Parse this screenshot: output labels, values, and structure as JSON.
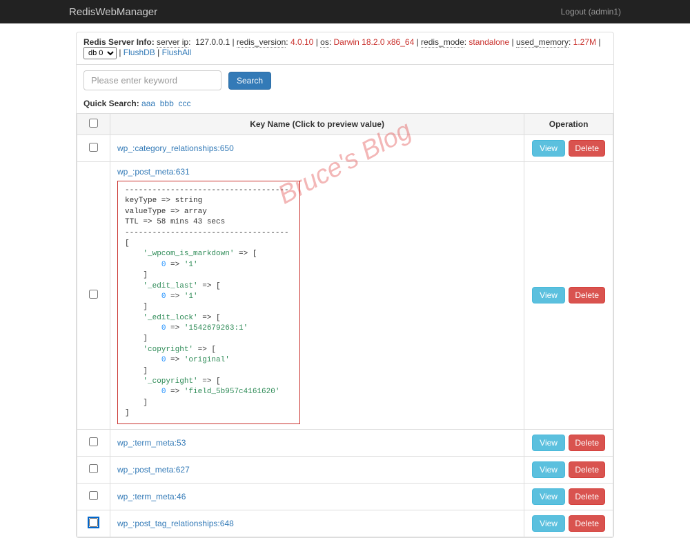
{
  "navbar": {
    "brand": "RedisWebManager",
    "logout": "Logout (admin1)"
  },
  "server_info": {
    "label": "Redis Server Info:",
    "server_ip_label": "server ip",
    "server_ip_value": "127.0.0.1",
    "redis_version_label": "redis_version",
    "redis_version_value": "4.0.10",
    "os_label": "os",
    "os_value": "Darwin 18.2.0 x86_64",
    "redis_mode_label": "redis_mode",
    "redis_mode_value": "standalone",
    "used_memory_label": "used_memory",
    "used_memory_value": "1.27M",
    "db_selected": "db 0",
    "flushdb": "FlushDB",
    "flushall": "FlushAll"
  },
  "search": {
    "placeholder": "Please enter keyword",
    "button": "Search"
  },
  "quick_search": {
    "label": "Quick Search:",
    "items": [
      "aaa",
      "bbb",
      "ccc"
    ]
  },
  "table": {
    "header": {
      "check": "",
      "keyname": "Key Name (Click to preview value)",
      "operation": "Operation"
    },
    "buttons": {
      "view": "View",
      "delete": "Delete"
    },
    "rows": [
      {
        "key": "wp_:category_relationships:650",
        "preview": false
      },
      {
        "key": "wp_:post_meta:631",
        "preview": true
      },
      {
        "key": "wp_:term_meta:53",
        "preview": false
      },
      {
        "key": "wp_:post_meta:627",
        "preview": false
      },
      {
        "key": "wp_:term_meta:46",
        "preview": false
      },
      {
        "key": "wp_:post_tag_relationships:648",
        "preview": false
      }
    ]
  },
  "preview": {
    "dashes1": "------------------------------------",
    "line1": "keyType => string",
    "line2": "valueType => array",
    "line3": "TTL => 58 mins 43 secs",
    "dashes2": "------------------------------------",
    "bracket_open": "[",
    "indent": "    ",
    "indent2": "        ",
    "arrow": " => ",
    "entries": [
      {
        "k": "'_wpcom_is_markdown'",
        "vopen": "[",
        "sub_k": "0",
        "sub_v": "'1'",
        "vclose": "]"
      },
      {
        "k": "'_edit_last'",
        "vopen": "[",
        "sub_k": "0",
        "sub_v": "'1'",
        "vclose": "]"
      },
      {
        "k": "'_edit_lock'",
        "vopen": "[",
        "sub_k": "0",
        "sub_v": "'1542679263:1'",
        "vclose": "]"
      },
      {
        "k": "'copyright'",
        "vopen": "[",
        "sub_k": "0",
        "sub_v": "'original'",
        "vclose": "]"
      },
      {
        "k": "'_copyright'",
        "vopen": "[",
        "sub_k": "0",
        "sub_v": "'field_5b957c4161620'",
        "vclose": "]"
      }
    ],
    "bracket_close": "]"
  },
  "watermark": "Bruce's Blog"
}
